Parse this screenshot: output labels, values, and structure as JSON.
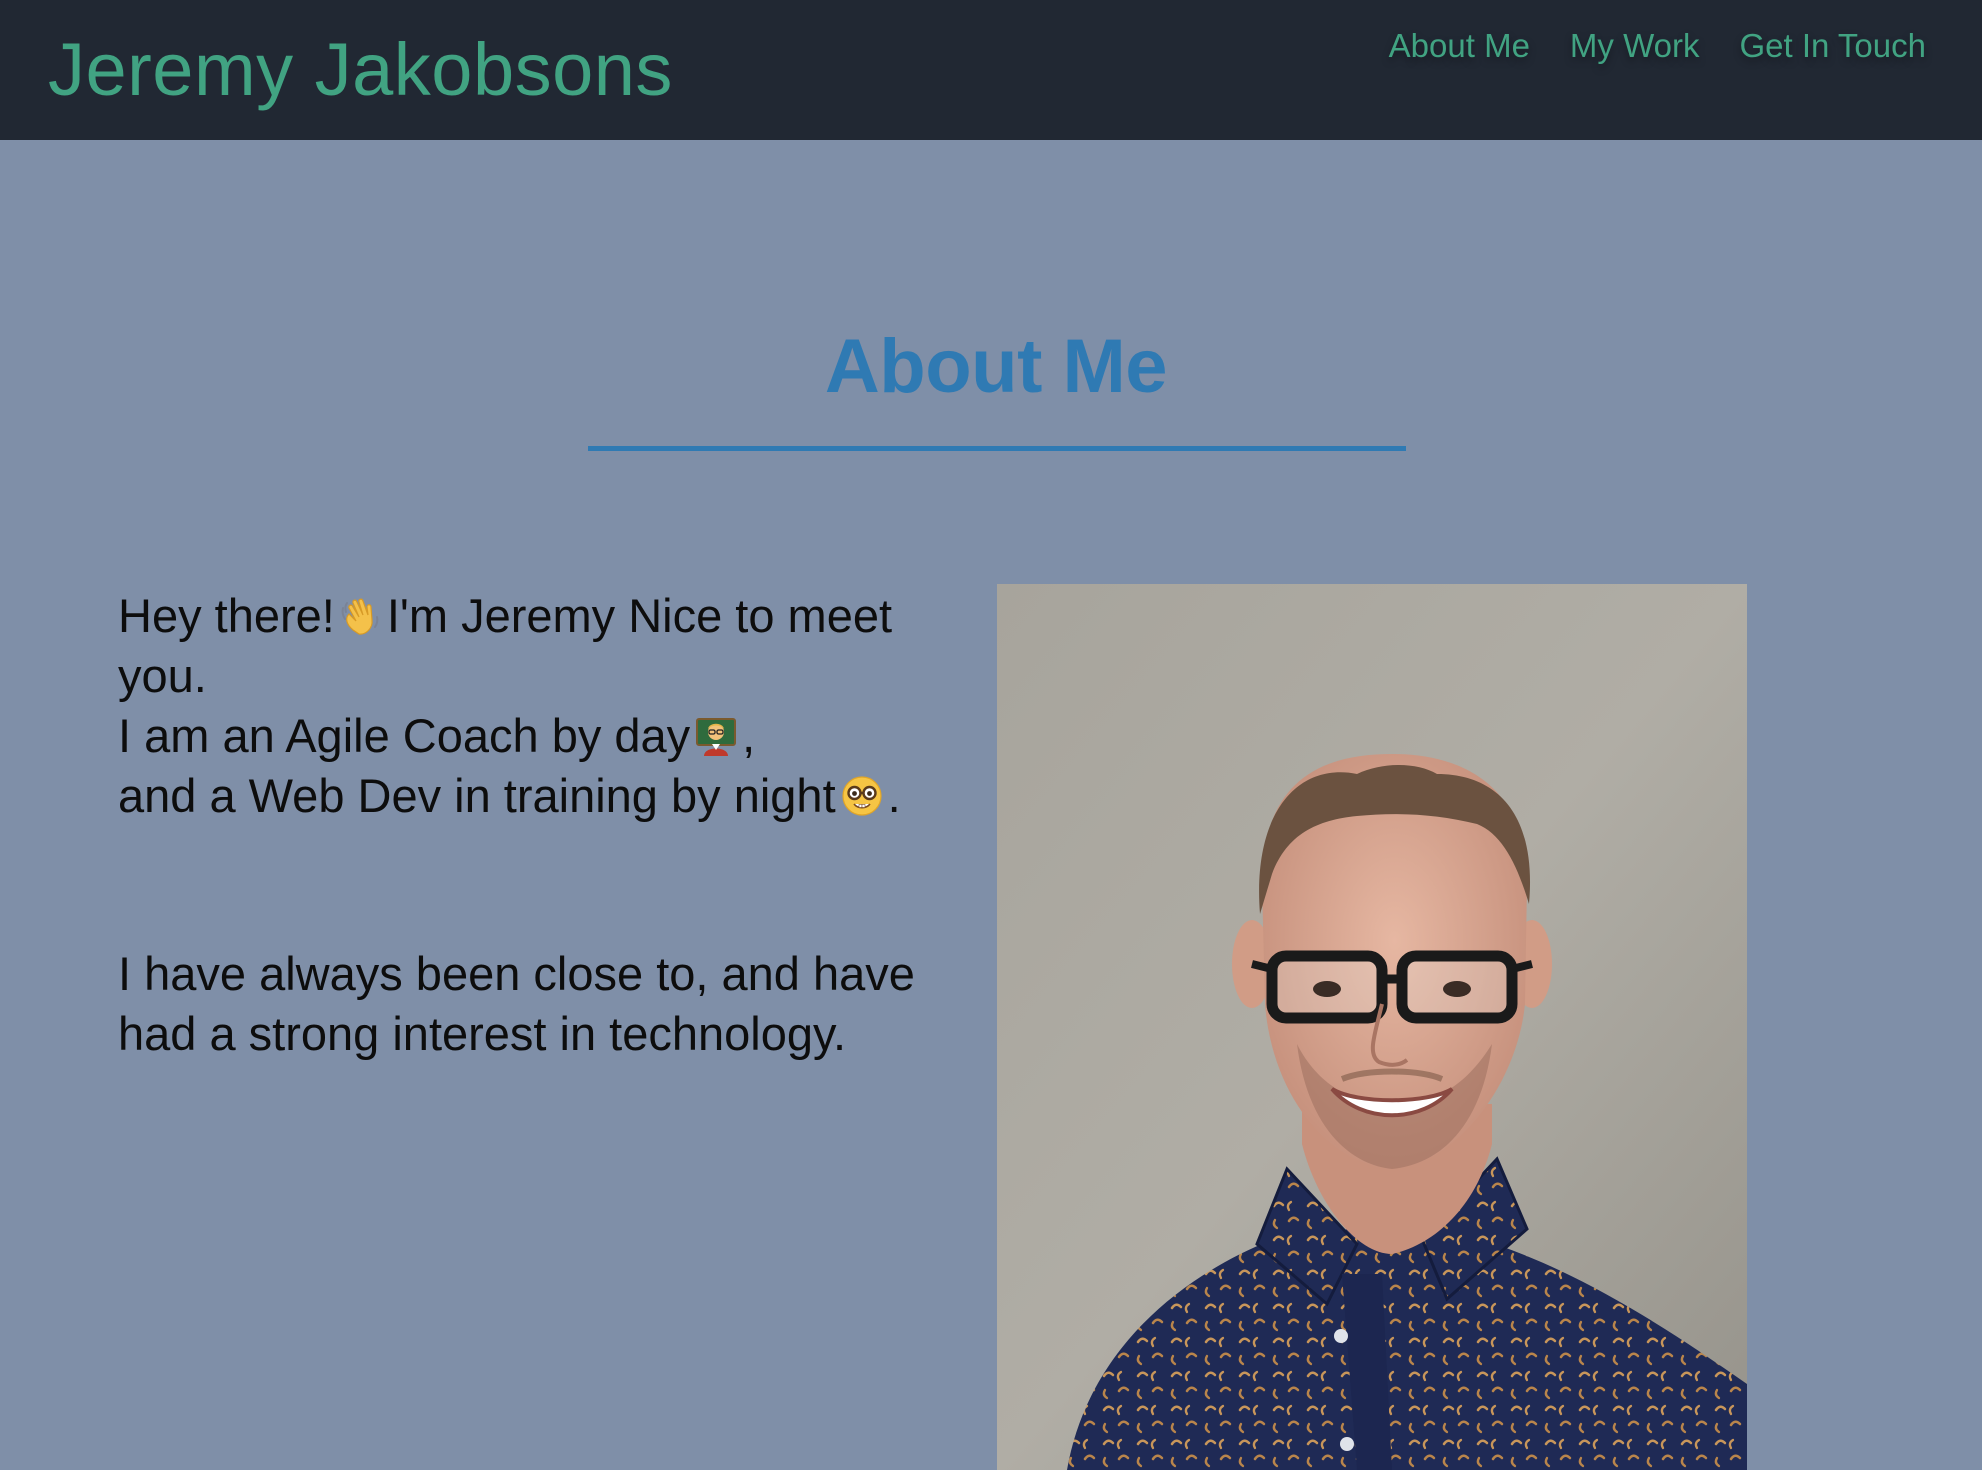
{
  "header": {
    "brand": "Jeremy Jakobsons",
    "nav": [
      {
        "label": "About Me"
      },
      {
        "label": "My Work"
      },
      {
        "label": "Get In Touch"
      }
    ]
  },
  "about": {
    "title": "About Me",
    "intro": {
      "line1_before_emoji": "Hey there!",
      "line1_after_emoji": "I'm Jeremy Nice to meet you.",
      "line2_before_emoji": "I am an Agile Coach by day",
      "line2_after_emoji": ",",
      "line3_before_emoji": "and a Web Dev in training by night",
      "line3_after_emoji": "."
    },
    "paragraph2": "I have always been close to, and have had a strong interest in technology."
  },
  "icons": {
    "wave": "waving-hand-icon",
    "teacher": "teacher-icon",
    "nerd": "nerd-face-icon"
  },
  "colors": {
    "nav_bg": "#212833",
    "page_bg": "#7f8fa8",
    "accent_green": "#41a382",
    "accent_blue": "#2f7ab3"
  }
}
